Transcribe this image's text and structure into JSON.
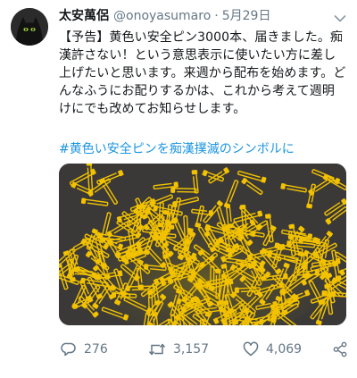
{
  "tweet": {
    "display_name": "太安萬侶",
    "handle": "@onoyasumaro",
    "separator": "·",
    "date": "5月29日",
    "text": "【予告】黄色い安全ピン3000本、届きました。痴漢許さない！という意思表示に使いたい方に差し上げたいと思います。来週から配布を始めます。どんなふうにお配りするかは、これから考えて週明けにでも改めてお知らせします。",
    "hashtag": "#黄色い安全ピンを痴漢撲滅のシンボルに"
  },
  "actions": {
    "reply": {
      "icon": "reply-icon",
      "count": "276"
    },
    "retweet": {
      "icon": "retweet-icon",
      "count": "3,157"
    },
    "like": {
      "icon": "heart-icon",
      "count": "4,069"
    },
    "share": {
      "icon": "share-icon"
    }
  },
  "colors": {
    "text": "#14171a",
    "secondary": "#657786",
    "link": "#1b95e0",
    "pin_yellow": "#f2c200",
    "photo_background": "#3b3938"
  }
}
